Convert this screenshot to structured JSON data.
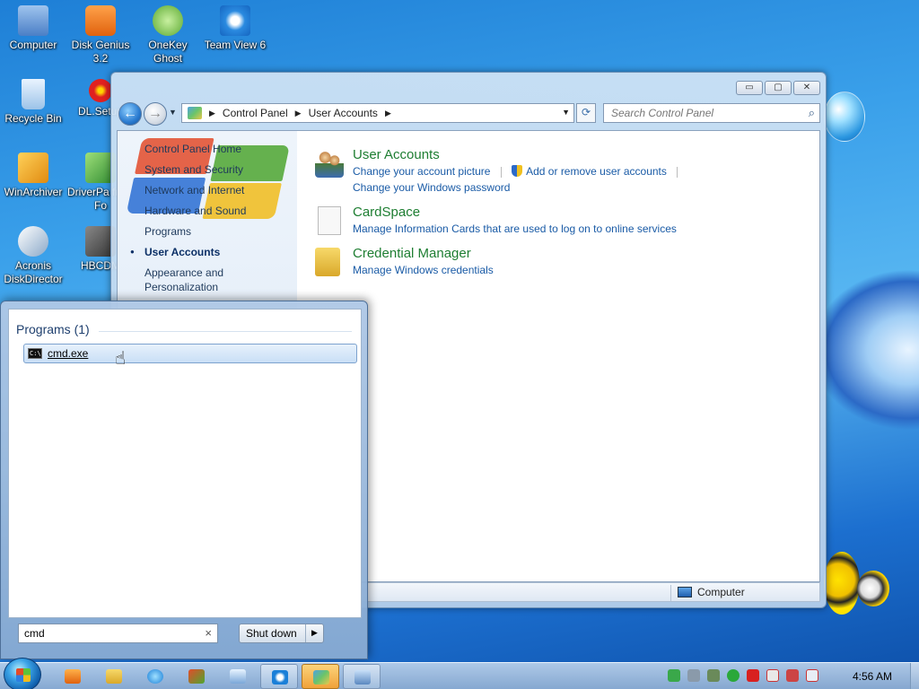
{
  "desktop": {
    "icons": [
      {
        "label": "Computer",
        "icon": "computer-icon",
        "color": "#5b8fd6"
      },
      {
        "label": "Disk Genius 3.2",
        "icon": "diskgenius-icon",
        "color": "#f07a1a"
      },
      {
        "label": "OneKey Ghost",
        "icon": "onekey-ghost-icon",
        "color": "#7bc043"
      },
      {
        "label": "Team View 6",
        "icon": "teamviewer-icon",
        "color": "#1a7fd8"
      },
      {
        "label": "Recycle Bin",
        "icon": "recycle-bin-icon",
        "color": "#9cc3e8"
      },
      {
        "label": "DL.Setup",
        "icon": "dl-setup-icon",
        "color": "#e02020"
      },
      {
        "label": "WinArchiver",
        "icon": "winarchiver-icon",
        "color": "#f2a628"
      },
      {
        "label": "DriverPa from Fo",
        "icon": "driverpack-icon",
        "color": "#3aa84a"
      },
      {
        "label": "Acronis DiskDirector",
        "icon": "acronis-icon",
        "color": "#d8e4f0"
      },
      {
        "label": "HBCDM",
        "icon": "hbcd-icon",
        "color": "#555555"
      }
    ]
  },
  "window": {
    "caption_buttons": {
      "minimize": "▭",
      "maximize": "▢",
      "close": "✕"
    },
    "address": {
      "root": "Control Panel",
      "current": "User Accounts"
    },
    "search_placeholder": "Search Control Panel",
    "left_nav": [
      {
        "label": "Control Panel Home",
        "active": false
      },
      {
        "label": "System and Security",
        "active": false
      },
      {
        "label": "Network and Internet",
        "active": false
      },
      {
        "label": "Hardware and Sound",
        "active": false
      },
      {
        "label": "Programs",
        "active": false
      },
      {
        "label": "User Accounts",
        "active": true
      },
      {
        "label": "Appearance and Personalization",
        "active": false
      }
    ],
    "sections": [
      {
        "title": "User Accounts",
        "icon": "user-accounts-icon",
        "links_row1": [
          "Change your account picture",
          "Add or remove user accounts"
        ],
        "links_row2": [
          "Change your Windows password"
        ]
      },
      {
        "title": "CardSpace",
        "icon": "cardspace-icon",
        "links_row1": [
          "Manage Information Cards that are used to log on to online services"
        ]
      },
      {
        "title": "Credential Manager",
        "icon": "credential-manager-icon",
        "links_row1": [
          "Manage Windows credentials"
        ]
      }
    ],
    "status": {
      "location": "Computer"
    }
  },
  "start_menu": {
    "header": "Programs (1)",
    "results": [
      {
        "label": "cmd.exe",
        "icon": "cmd-icon"
      }
    ],
    "search_value": "cmd",
    "shutdown_label": "Shut down"
  },
  "taskbar": {
    "buttons": [
      {
        "icon": "media-player-icon",
        "open": false
      },
      {
        "icon": "explorer-icon",
        "open": false
      },
      {
        "icon": "internet-explorer-icon",
        "open": false
      },
      {
        "icon": "network-tool-icon",
        "open": false
      },
      {
        "icon": "app-icon",
        "open": false
      },
      {
        "icon": "teamviewer-icon",
        "open": true
      },
      {
        "icon": "control-panel-icon",
        "open": true,
        "active": true
      },
      {
        "icon": "remote-desktop-icon",
        "open": true
      }
    ],
    "clock": "4:56 AM"
  },
  "colors": {
    "link": "#1a5ba6",
    "section_title": "#1e7e32",
    "desktop": "#2a8be0"
  }
}
